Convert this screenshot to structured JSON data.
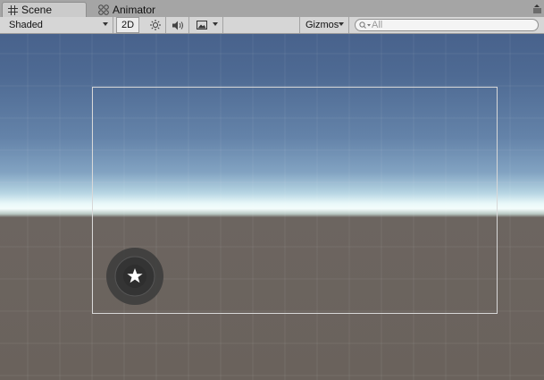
{
  "tabs": [
    {
      "label": "Scene",
      "icon": "grid-icon",
      "active": true
    },
    {
      "label": "Animator",
      "icon": "animator-icon",
      "active": false
    }
  ],
  "toolbar": {
    "shading_mode": "Shaded",
    "mode_2d_label": "2D",
    "gizmos_label": "Gizmos",
    "search_placeholder": "All"
  },
  "colors": {
    "sky_top": "#48628c",
    "horizon": "#f4fdfc",
    "ground": "#6a625c",
    "camera_frame": "#d8d8d8",
    "joystick": "#3c3c3c"
  }
}
